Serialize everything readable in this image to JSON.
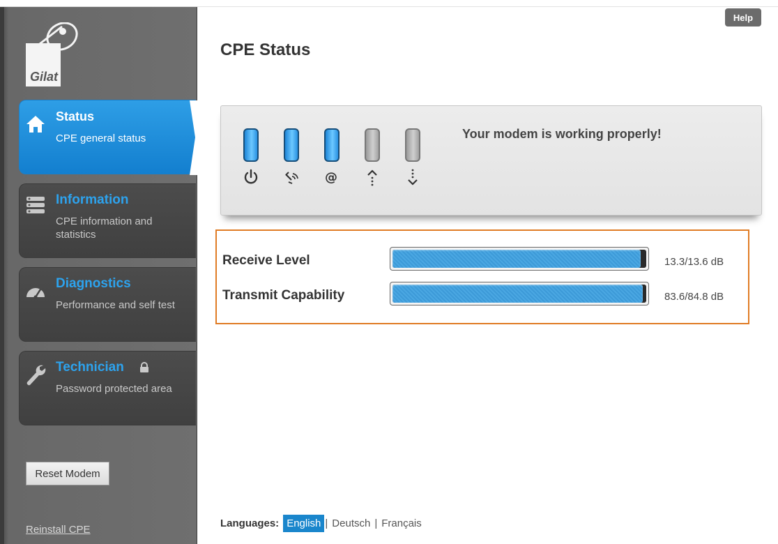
{
  "sidebar": {
    "logo_text": "Gilat",
    "items": [
      {
        "title": "Status",
        "desc": "CPE general status",
        "icon": "home-icon"
      },
      {
        "title": "Information",
        "desc": "CPE information and statistics",
        "icon": "list-icon"
      },
      {
        "title": "Diagnostics",
        "desc": "Performance and self test",
        "icon": "gauge-icon"
      },
      {
        "title": "Technician",
        "desc": "Password protected area",
        "icon": "wrench-icon"
      }
    ],
    "reset_label": "Reset Modem",
    "reinstall_label": "Reinstall CPE"
  },
  "header": {
    "help_label": "Help",
    "title": "CPE Status"
  },
  "status_panel": {
    "message": "Your modem is working properly!",
    "leds": [
      {
        "name": "power",
        "state": "on",
        "icon": "power-icon"
      },
      {
        "name": "satellite",
        "state": "on",
        "icon": "satellite-icon"
      },
      {
        "name": "internet",
        "state": "on",
        "icon": "at-icon"
      },
      {
        "name": "transmit",
        "state": "off",
        "icon": "upload-icon"
      },
      {
        "name": "receive",
        "state": "off",
        "icon": "download-icon"
      }
    ]
  },
  "signals": [
    {
      "label": "Receive Level",
      "value": "13.3/13.6 dB",
      "level": 0.978
    },
    {
      "label": "Transmit Capability",
      "value": "83.6/84.8 dB",
      "level": 0.986
    }
  ],
  "languages": {
    "label": "Languages:",
    "options": [
      "English",
      "Deutsch",
      "Français"
    ],
    "selected": "English"
  },
  "colors": {
    "accent": "#2da3ee",
    "active_nav": "#1a86cc",
    "highlight_border": "#e07b24",
    "led_on": "#3aa8ee",
    "led_off": "#a8a8a8"
  }
}
